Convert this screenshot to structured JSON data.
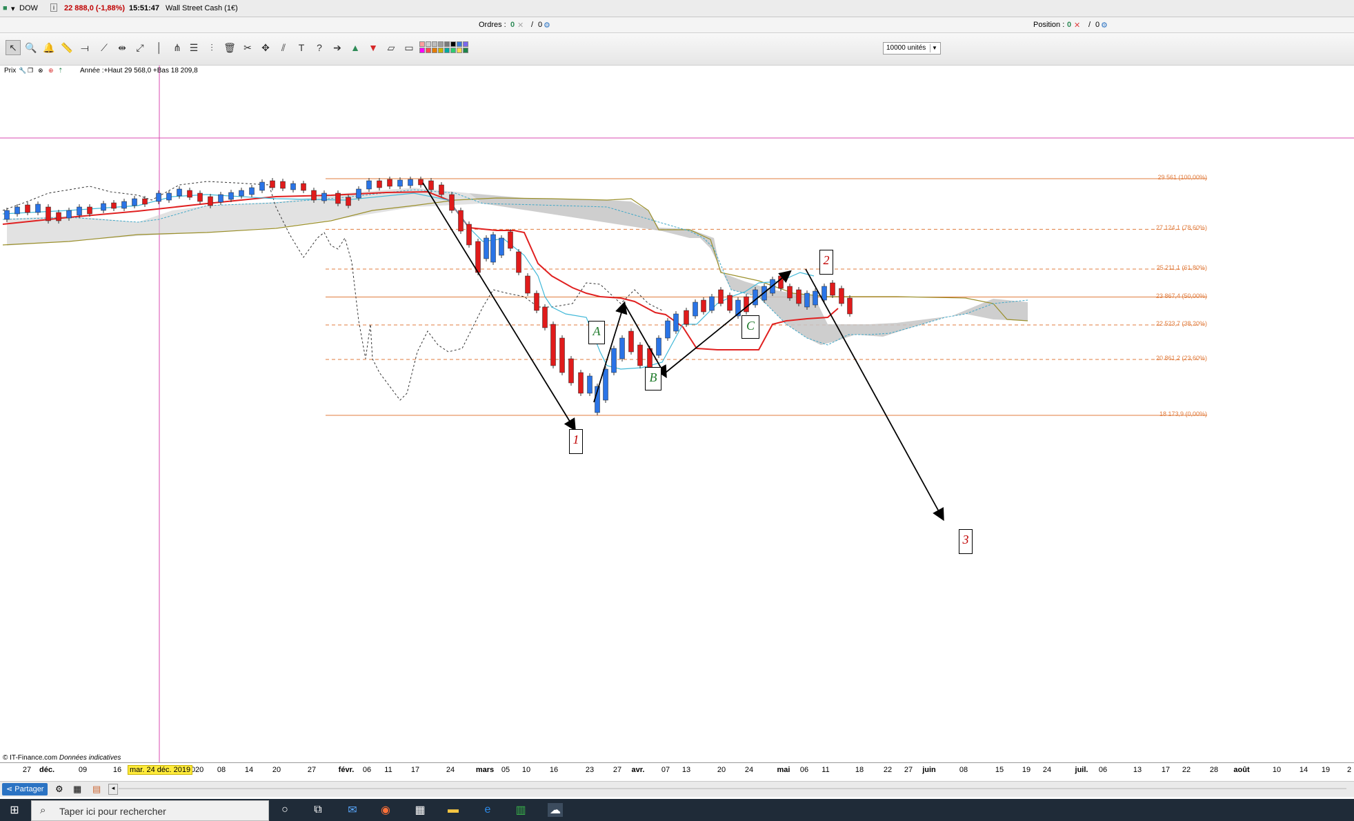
{
  "topbar": {
    "instrument": "DOW",
    "info_icon": "i",
    "change": "22 888,0 (-1,88%)",
    "time": "15:51:47",
    "instrument_name": "Wall Street Cash (1€)"
  },
  "orders_bar": {
    "orders_label": "Ordres :",
    "orders_value": "0",
    "orders_sep": "/",
    "orders_value2": "0",
    "position_label": "Position :",
    "position_value": "0",
    "position_sep": "/",
    "position_value2": "0"
  },
  "toolbar": {
    "units": "10000 unités",
    "colors": [
      "#ff9e9e",
      "#cfcfcf",
      "#bdbdbd",
      "#9d9d9d",
      "#7a7a7a",
      "#000000",
      "#3a7bd5",
      "#7b68ee",
      "#ff00ff",
      "#ff4d4d",
      "#e57c00",
      "#c9b400",
      "#00a9a0",
      "#2ecc71",
      "#ffd54f",
      "#1e8449"
    ]
  },
  "price_panel": {
    "label": "Prix",
    "annual_info": "Année :+Haut 29 568,0 +Bas 18 209,8"
  },
  "fib_levels": [
    {
      "label": "29 561 (100,00%)",
      "value": 29561,
      "style": "solid"
    },
    {
      "label": "27 124,1 (78,60%)",
      "value": 27124.1,
      "style": "dashed"
    },
    {
      "label": "25 211,1 (61,80%)",
      "value": 25211.1,
      "style": "dashed"
    },
    {
      "label": "23 867,4 (50,00%)",
      "value": 23867.4,
      "style": "solid"
    },
    {
      "label": "22 523,7 (38,20%)",
      "value": 22523.7,
      "style": "dashed"
    },
    {
      "label": "20 861,2 (23,60%)",
      "value": 20861.2,
      "style": "dashed"
    },
    {
      "label": "18 173,9 (0,00%)",
      "value": 18173.9,
      "style": "solid"
    }
  ],
  "wave_labels": [
    "1",
    "2",
    "3",
    "A",
    "B",
    "C"
  ],
  "copyright": "© IT-Finance.com",
  "copyright_note": "Données indicatives",
  "xaxis": {
    "date_tooltip": "mar. 24 déc. 2019",
    "ticks": [
      "27",
      "déc.",
      "09",
      "16",
      "2020",
      "08",
      "14",
      "20",
      "27",
      "févr.",
      "06",
      "11",
      "17",
      "24",
      "mars",
      "05",
      "10",
      "16",
      "23",
      "27",
      "avr.",
      "07",
      "13",
      "20",
      "24",
      "mai",
      "06",
      "11",
      "18",
      "22",
      "27",
      "juin",
      "08",
      "15",
      "19",
      "24",
      "juil.",
      "06",
      "13",
      "17",
      "22",
      "28",
      "août",
      "10",
      "14",
      "19",
      "2"
    ]
  },
  "bottombar": {
    "share": "Partager"
  },
  "taskbar": {
    "search_placeholder": "Taper ici pour rechercher"
  }
}
